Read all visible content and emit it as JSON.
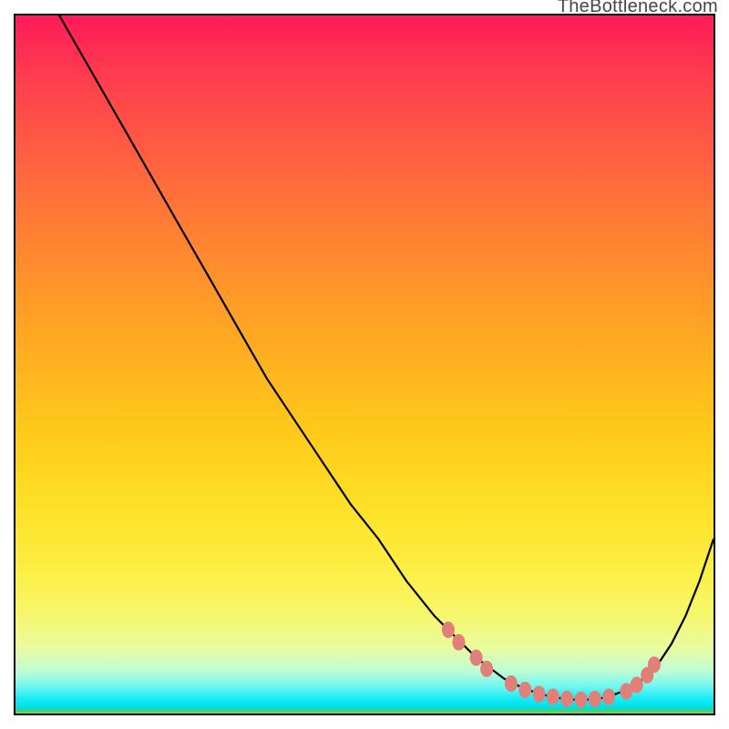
{
  "attribution": "TheBottleneck.com",
  "chart_data": {
    "type": "line",
    "title": "",
    "xlabel": "",
    "ylabel": "",
    "x_range": [
      0,
      100
    ],
    "y_range": [
      0,
      100
    ],
    "series": [
      {
        "name": "curve",
        "x": [
          0,
          4,
          8,
          12,
          16,
          20,
          24,
          28,
          32,
          36,
          40,
          44,
          48,
          52,
          56,
          60,
          62,
          64,
          66,
          68,
          70,
          72,
          74,
          76,
          78,
          80,
          82,
          84,
          86,
          88,
          90,
          92,
          94,
          96,
          98,
          100
        ],
        "y": [
          110,
          104,
          97,
          90,
          83,
          76,
          69,
          62,
          55,
          48,
          42,
          36,
          30,
          25,
          19,
          14,
          12,
          10,
          8,
          6.5,
          5,
          4,
          3.2,
          2.6,
          2.2,
          2.0,
          2.0,
          2.2,
          2.8,
          3.6,
          5,
          7,
          10,
          14,
          19,
          25
        ]
      }
    ],
    "markers": {
      "name": "highlight-points",
      "color": "#e08078",
      "points": [
        {
          "x": 62,
          "y": 12
        },
        {
          "x": 63.5,
          "y": 10.2
        },
        {
          "x": 66,
          "y": 8
        },
        {
          "x": 67.5,
          "y": 6.4
        },
        {
          "x": 71,
          "y": 4.3
        },
        {
          "x": 73,
          "y": 3.4
        },
        {
          "x": 75,
          "y": 2.8
        },
        {
          "x": 77,
          "y": 2.4
        },
        {
          "x": 79,
          "y": 2.1
        },
        {
          "x": 81,
          "y": 2.0
        },
        {
          "x": 83,
          "y": 2.1
        },
        {
          "x": 85,
          "y": 2.4
        },
        {
          "x": 87.5,
          "y": 3.2
        },
        {
          "x": 89,
          "y": 4.1
        },
        {
          "x": 90.5,
          "y": 5.5
        },
        {
          "x": 91.5,
          "y": 7.0
        }
      ]
    },
    "gradient_stops": [
      {
        "pos": 0,
        "color": "#ff1a59"
      },
      {
        "pos": 0.5,
        "color": "#ffc11c"
      },
      {
        "pos": 0.86,
        "color": "#f7f76e"
      },
      {
        "pos": 0.95,
        "color": "#72f7f1"
      },
      {
        "pos": 1.0,
        "color": "#aad023"
      }
    ]
  }
}
